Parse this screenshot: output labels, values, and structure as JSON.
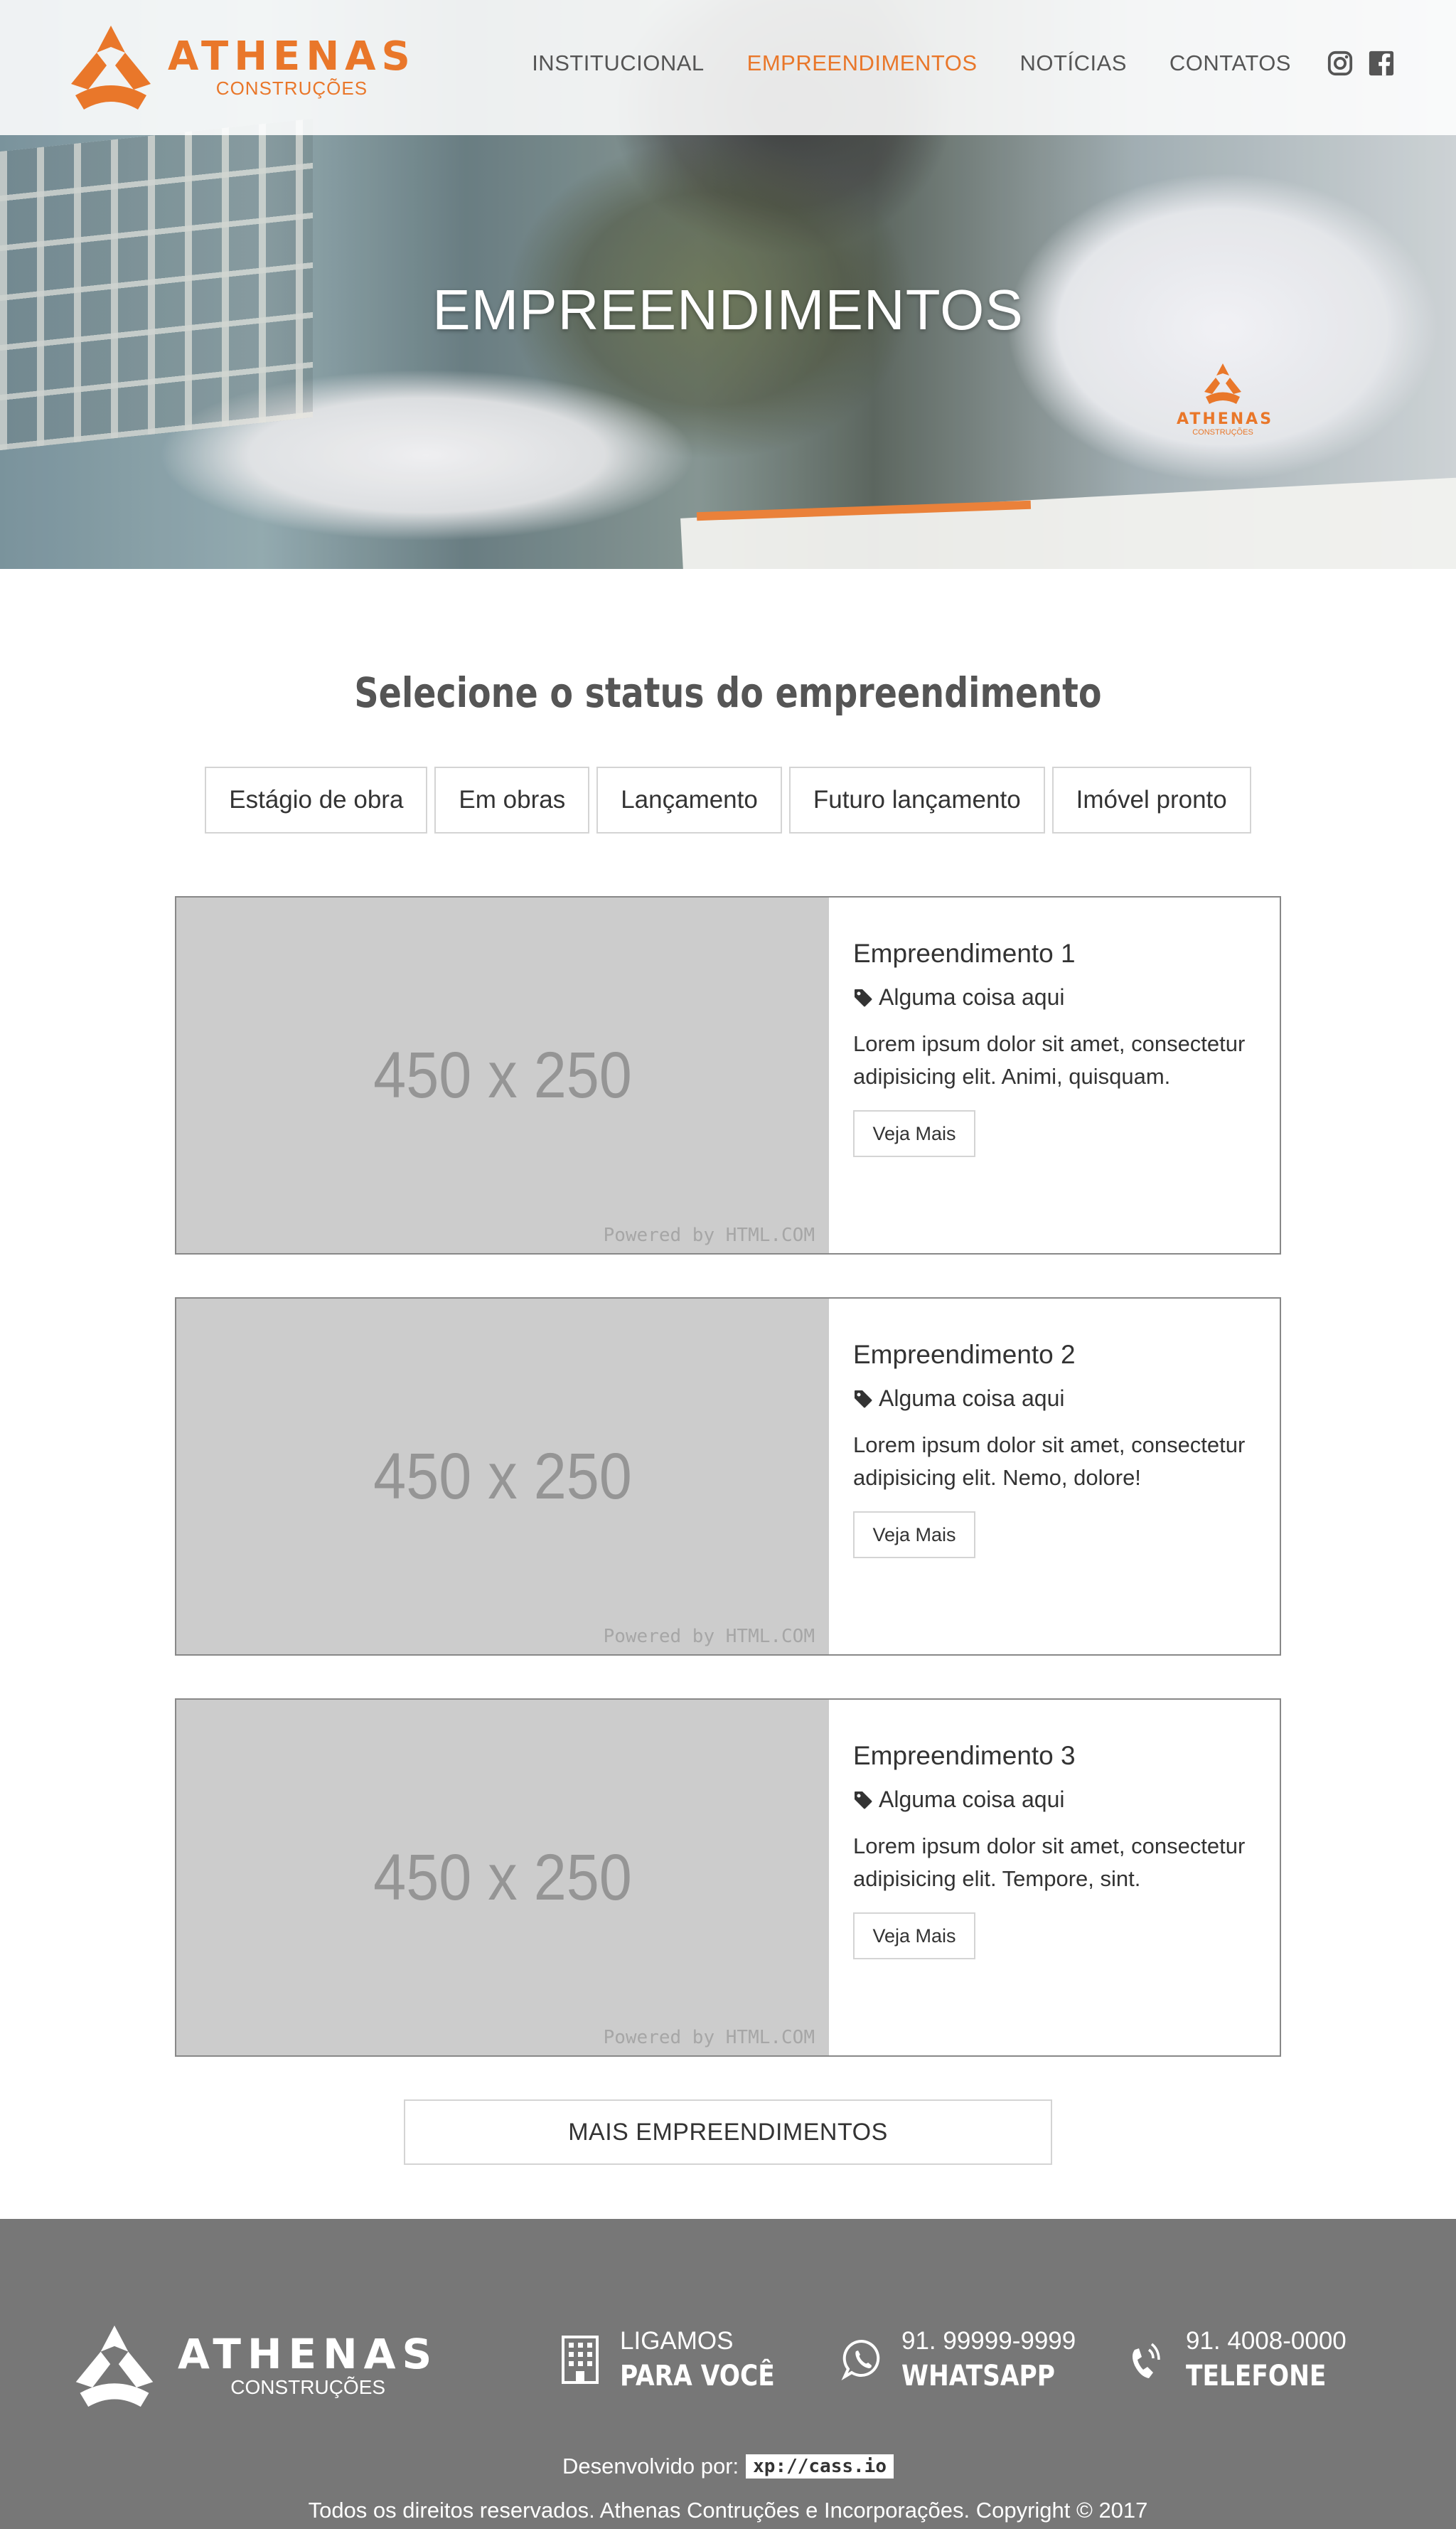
{
  "brand": {
    "name": "ATHENAS",
    "sub": "CONSTRUÇÕES",
    "color": "#e9772a"
  },
  "nav": {
    "items": [
      "INSTITUCIONAL",
      "EMPREENDIMENTOS",
      "NOTÍCIAS",
      "CONTATOS"
    ],
    "active": "EMPREENDIMENTOS"
  },
  "hero": {
    "title": "EMPREENDIMENTOS"
  },
  "filter": {
    "title": "Selecione o status do empreendimento",
    "options": [
      "Estágio de obra",
      "Em obras",
      "Lançamento",
      "Futuro lançamento",
      "Imóvel pronto"
    ]
  },
  "cards": [
    {
      "image_label": "450 x 250",
      "powered": "Powered by HTML.COM",
      "title": "Empreendimento 1",
      "tag": "Alguma coisa aqui",
      "desc": "Lorem ipsum dolor sit amet, consectetur adipisicing elit. Animi, quisquam.",
      "button": "Veja Mais"
    },
    {
      "image_label": "450 x 250",
      "powered": "Powered by HTML.COM",
      "title": "Empreendimento 2",
      "tag": "Alguma coisa aqui",
      "desc": "Lorem ipsum dolor sit amet, consectetur adipisicing elit. Nemo, dolore!",
      "button": "Veja Mais"
    },
    {
      "image_label": "450 x 250",
      "powered": "Powered by HTML.COM",
      "title": "Empreendimento 3",
      "tag": "Alguma coisa aqui",
      "desc": "Lorem ipsum dolor sit amet, consectetur adipisicing elit. Tempore, sint.",
      "button": "Veja Mais"
    }
  ],
  "more_button": "MAIS EMPREENDIMENTOS",
  "footer": {
    "contacts": [
      {
        "icon": "building-icon",
        "line1": "LIGAMOS",
        "line2": "PARA VOCÊ"
      },
      {
        "icon": "whatsapp-icon",
        "line1": "91. 99999-9999",
        "line2": "WHATSAPP"
      },
      {
        "icon": "phone-icon",
        "line1": "91. 4008-0000",
        "line2": "TELEFONE"
      }
    ],
    "developed_by": "Desenvolvido por:",
    "developer": "xp://cass.io",
    "rights": "Todos os direitos reservados. Athenas Contruções e Incorporações. Copyright © 2017",
    "background": "#777777"
  },
  "social": [
    "instagram-icon",
    "facebook-icon"
  ]
}
